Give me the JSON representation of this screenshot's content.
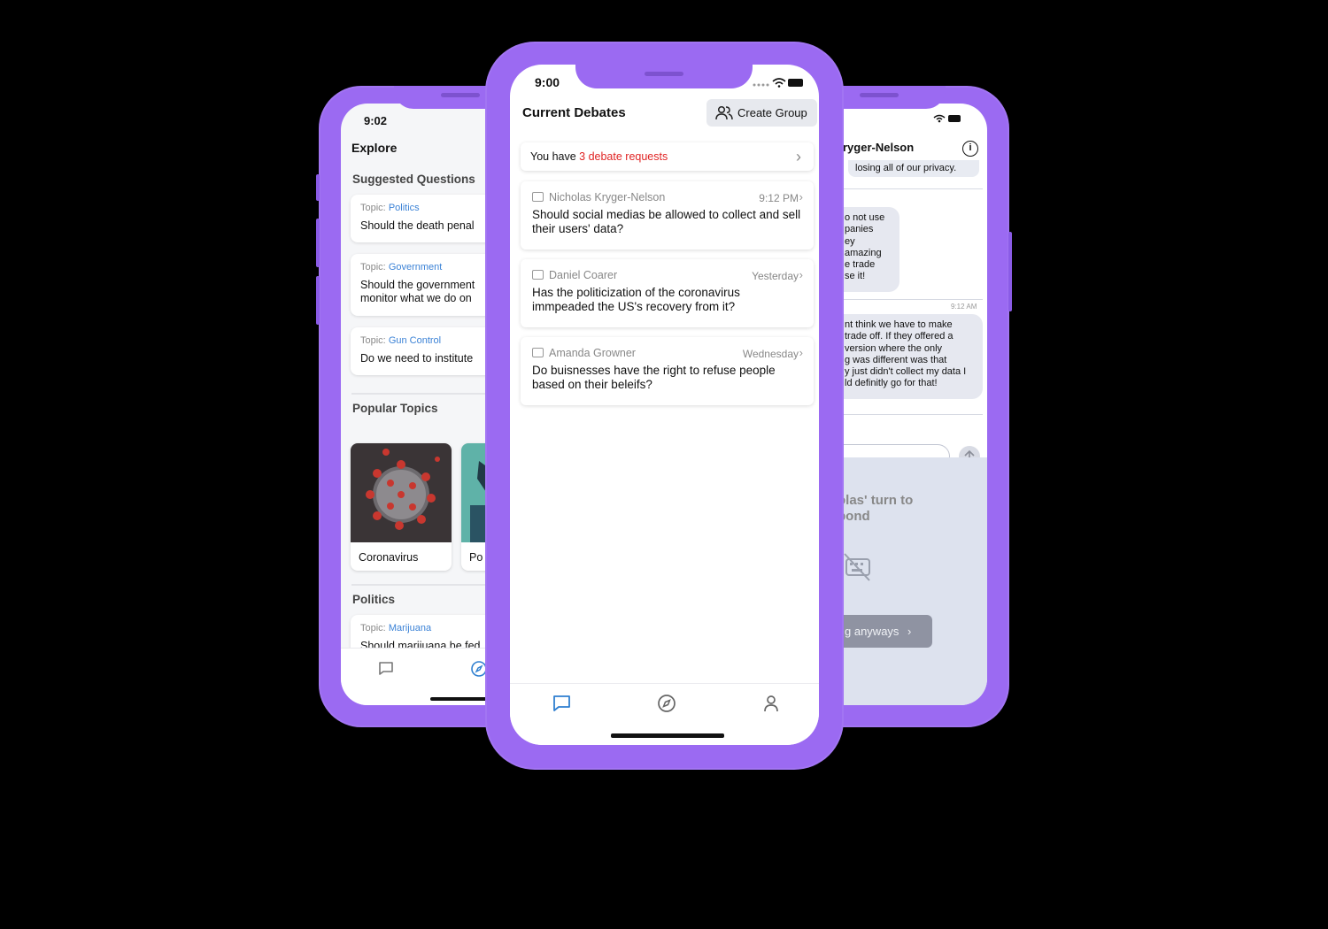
{
  "colors": {
    "phone_body": "#9b6af2",
    "link_blue": "#3b82d6",
    "request_red": "#e02424",
    "active_tab": "#2f7fd0"
  },
  "left_phone": {
    "time": "9:02",
    "title": "Explore",
    "suggested_heading": "Suggested Questions",
    "questions": [
      {
        "topic_label": "Topic:",
        "topic": "Politics",
        "text": "Should the death penal"
      },
      {
        "topic_label": "Topic:",
        "topic": "Government",
        "text": "Should the government monitor what we do on"
      },
      {
        "topic_label": "Topic:",
        "topic": "Gun Control",
        "text": "Do we need to institute"
      }
    ],
    "popular_heading": "Popular Topics",
    "topics": [
      "Coronavirus",
      "Po"
    ],
    "politics_heading": "Politics",
    "politics_question": {
      "topic_label": "Topic:",
      "topic": "Marijuana",
      "text": "Should marijuana be fed"
    },
    "tabs": [
      {
        "icon": "chat-icon"
      },
      {
        "icon": "compass-icon"
      }
    ]
  },
  "center_phone": {
    "time": "9:00",
    "title": "Current Debates",
    "create_group_label": "Create Group",
    "requests": {
      "prefix": "You have ",
      "highlight": "3 debate requests"
    },
    "debates": [
      {
        "name": "Nicholas Kryger-Nelson",
        "time": "9:12 PM",
        "question": "Should social medias be allowed to collect and sell their users' data?"
      },
      {
        "name": "Daniel Coarer",
        "time": "Yesterday",
        "question": "Has the politicization of the coronavirus immpeaded the US's recovery from it?"
      },
      {
        "name": "Amanda Growner",
        "time": "Wednesday",
        "question": "Do buisnesses have the right to refuse people based on their beleifs?"
      }
    ],
    "tabs": [
      {
        "icon": "chat-icon",
        "active": true
      },
      {
        "icon": "compass-icon"
      },
      {
        "icon": "person-icon"
      }
    ]
  },
  "right_phone": {
    "title": "ryger-Nelson",
    "messages": [
      {
        "text": "losing all of our privacy."
      },
      {
        "text": "o not use\npanies\ney\namazing\ne trade\nse it!"
      },
      {
        "text": "nt think we have to make\ntrade off. If they offered a\n version where the only\ng was different was that\ny just didn't collect my data I\nld definitly go for that!"
      }
    ],
    "msg_time": "9:12 AM",
    "turn_text": "olas' turn to\npond",
    "anyways_label": "g anyways"
  }
}
